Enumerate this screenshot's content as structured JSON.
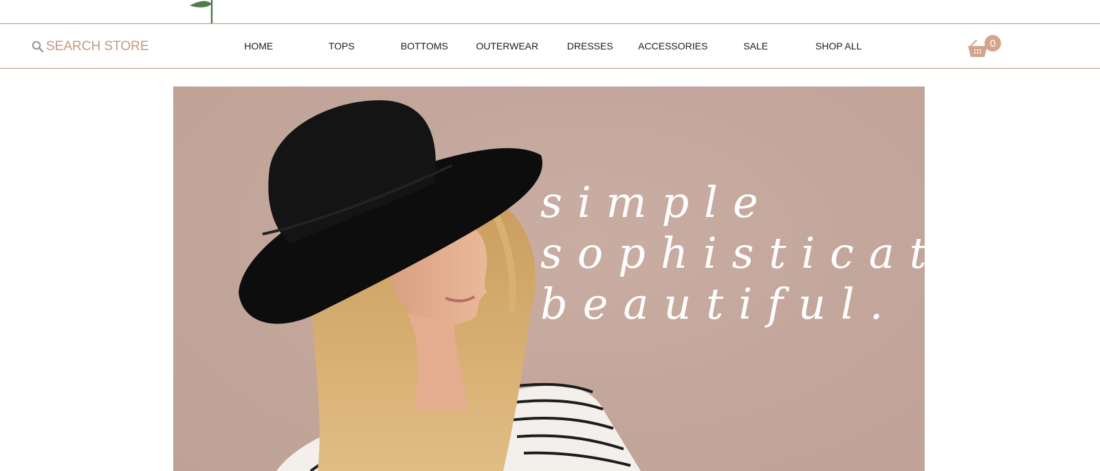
{
  "header": {
    "search_label": "SEARCH STORE",
    "nav": [
      {
        "label": "HOME"
      },
      {
        "label": "TOPS"
      },
      {
        "label": "BOTTOMS"
      },
      {
        "label": "OUTERWEAR"
      },
      {
        "label": "DRESSES"
      },
      {
        "label": "ACCESSORIES"
      },
      {
        "label": "SALE"
      },
      {
        "label": "SHOP ALL"
      }
    ],
    "cart_count": "0"
  },
  "hero": {
    "tagline": [
      "simple",
      "sophisticated",
      "beautiful."
    ]
  },
  "colors": {
    "accent": "#d6a38c",
    "search_text": "#c4987f",
    "divider": "#b89585",
    "hero_background": "#c4a79c",
    "logo_green": "#4f7d4a"
  },
  "icons": [
    "leaf-sprig-logo",
    "search-icon",
    "cart-icon"
  ]
}
